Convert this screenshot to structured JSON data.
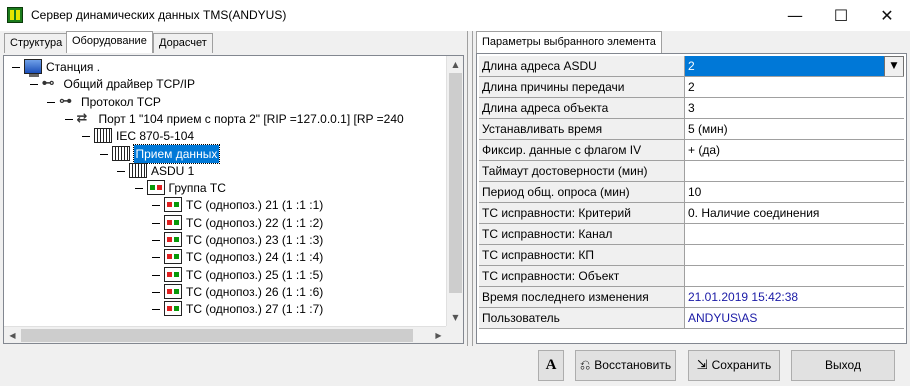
{
  "window": {
    "title": "Сервер динамических данных TMS(ANDYUS)",
    "controls": {
      "minimize": "—",
      "maximize": "☐",
      "close": "✕"
    }
  },
  "left_tabs": [
    {
      "label": "Структура"
    },
    {
      "label": "Оборудование",
      "active": true
    },
    {
      "label": "Дорасчет"
    }
  ],
  "tree": [
    {
      "label": "Станция .",
      "icon": "station-icon",
      "level": 0
    },
    {
      "label": "Общий драйвер TCP/IP",
      "icon": "network-driver-icon",
      "level": 1
    },
    {
      "label": "Протокол TCP",
      "icon": "protocol-icon",
      "level": 2
    },
    {
      "label": "Порт  1 \"104 прием с порта 2\" [RIP =127.0.0.1] [RP =240",
      "icon": "port-icon",
      "level": 3
    },
    {
      "label": "IEC 870-5-104",
      "icon": "rack-icon",
      "level": 4
    },
    {
      "label": "Прием данных",
      "icon": "rack-icon",
      "level": 5,
      "selected": true
    },
    {
      "label": "ASDU 1",
      "icon": "rack-icon",
      "level": 6
    },
    {
      "label": "Группа ТС",
      "icon": "group-icon",
      "level": 7
    },
    {
      "label": "ТС (однопоз.)  21 (1 :1 :1)",
      "icon": "tc-icon",
      "level": 8
    },
    {
      "label": "ТС (однопоз.)  22 (1 :1 :2)",
      "icon": "tc-icon",
      "level": 8
    },
    {
      "label": "ТС (однопоз.)  23 (1 :1 :3)",
      "icon": "tc-icon",
      "level": 8
    },
    {
      "label": "ТС (однопоз.)  24 (1 :1 :4)",
      "icon": "tc-icon",
      "level": 8
    },
    {
      "label": "ТС (однопоз.)  25 (1 :1 :5)",
      "icon": "tc-icon",
      "level": 8
    },
    {
      "label": "ТС (однопоз.)  26 (1 :1 :6)",
      "icon": "tc-icon",
      "level": 8
    },
    {
      "label": "ТС (однопоз.)  27 (1 :1 :7)",
      "icon": "tc-icon",
      "level": 8
    }
  ],
  "props_tab": {
    "label": "Параметры выбранного элемента"
  },
  "properties": [
    {
      "name": "Длина адреса ASDU",
      "value": "2",
      "dropdown": true,
      "selected": true
    },
    {
      "name": "Длина причины передачи",
      "value": "2"
    },
    {
      "name": "Длина адреса объекта",
      "value": "3"
    },
    {
      "name": "Устанавливать время",
      "value": "5 (мин)"
    },
    {
      "name": "Фиксир. данные с флагом IV",
      "value": "+ (да)"
    },
    {
      "name": "Таймаут достоверности (мин)",
      "value": ""
    },
    {
      "name": "Период общ. опроса (мин)",
      "value": "10"
    },
    {
      "name": "ТС исправности: Критерий",
      "value": "0. Наличие соединения"
    },
    {
      "name": "ТС исправности: Канал",
      "value": ""
    },
    {
      "name": "ТС исправности: КП",
      "value": ""
    },
    {
      "name": "ТС исправности: Объект",
      "value": ""
    },
    {
      "name": "Время последнего изменения",
      "value": "21.01.2019 15:42:38",
      "blue": true
    },
    {
      "name": "Пользователь",
      "value": "ANDYUS\\AS",
      "blue": true
    }
  ],
  "buttons": {
    "font": "A",
    "restore": "Восстановить",
    "save": "Сохранить",
    "exit": "Выход"
  }
}
